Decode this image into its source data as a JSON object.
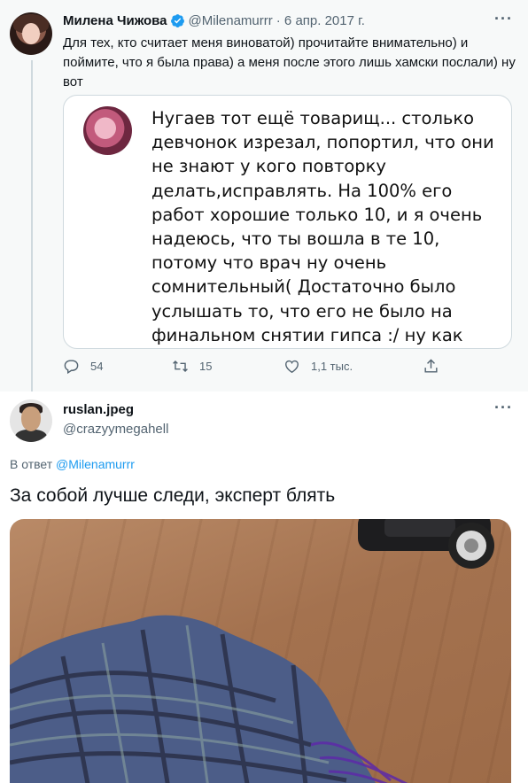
{
  "tweet1": {
    "author_name": "Милена Чижова",
    "author_handle": "@Milenamurrr",
    "date": "· 6 апр. 2017 г.",
    "text": "Для тех, кто считает меня виноватой) прочитайте внимательно) и поймите, что я была права) а меня после этого лишь хамски послали) ну вот",
    "image_text": "Нугаев тот ещё товарищ... столько девчонок изрезал, попортил, что они не знают у кого повторку делать,исправлять. На 100% его работ хорошие только 10, и я очень надеюсь, что ты вошла в те 10, потому что врач ну очень сомнительный( Достаточно было услышать то, что его не было на финальном снятии гипса :/ ну как так? Жесть.. и что тошнило кровью,это",
    "replies": "54",
    "retweets": "15",
    "likes": "1,1 тыс."
  },
  "tweet2": {
    "author_name": "ruslan.jpeg",
    "author_handle": "@crazyymegahell",
    "reply_prefix": "В ответ",
    "reply_to": "@Milenamurrr",
    "text": "За собой лучше следи, эксперт блять"
  },
  "colors": {
    "accent": "#1d9bf0",
    "muted": "#536471",
    "border": "#cfd9de",
    "parent_bg": "#f7f9f9"
  },
  "icons": [
    "verified-badge-icon",
    "more-icon",
    "reply-icon",
    "retweet-icon",
    "like-icon",
    "share-icon"
  ]
}
